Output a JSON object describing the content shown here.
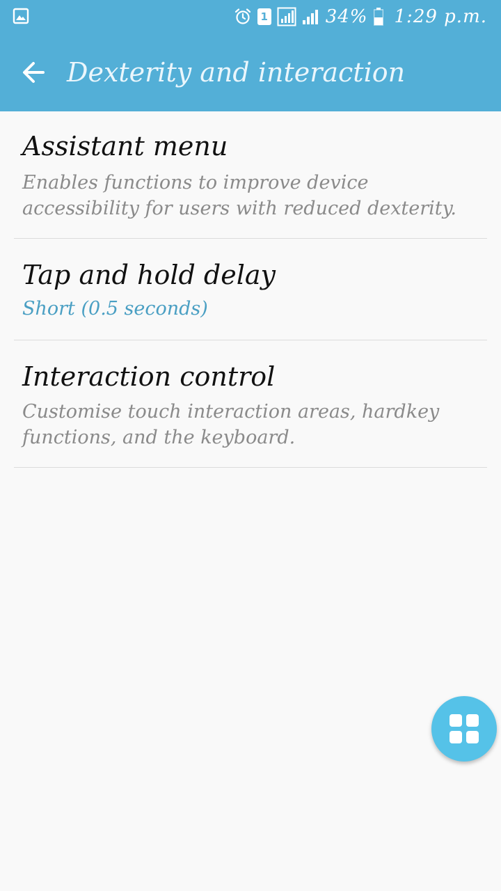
{
  "status_bar": {
    "icons": [
      "gallery-icon",
      "alarm-icon",
      "sim-1-icon",
      "wifi-signal-icon",
      "cell-signal-icon",
      "battery-icon"
    ],
    "sim_label": "1",
    "battery": "34%",
    "time": "1:29 p.m."
  },
  "app_bar": {
    "back_icon": "arrow-left-icon",
    "title": "Dexterity and interaction"
  },
  "items": [
    {
      "title": "Assistant menu",
      "subtitle": "Enables functions to improve device accessibility for users with reduced dexterity."
    },
    {
      "title": "Tap and hold delay",
      "subtitle": "Short (0.5 seconds)"
    },
    {
      "title": "Interaction control",
      "subtitle": "Customise touch interaction areas, hardkey functions, and the keyboard."
    }
  ],
  "fab": {
    "icon": "grid-icon"
  },
  "colors": {
    "app_bar": "#53afd7",
    "background": "#f9f9f9",
    "accent_value": "#4a9fc3",
    "fab": "#55c2e8"
  }
}
